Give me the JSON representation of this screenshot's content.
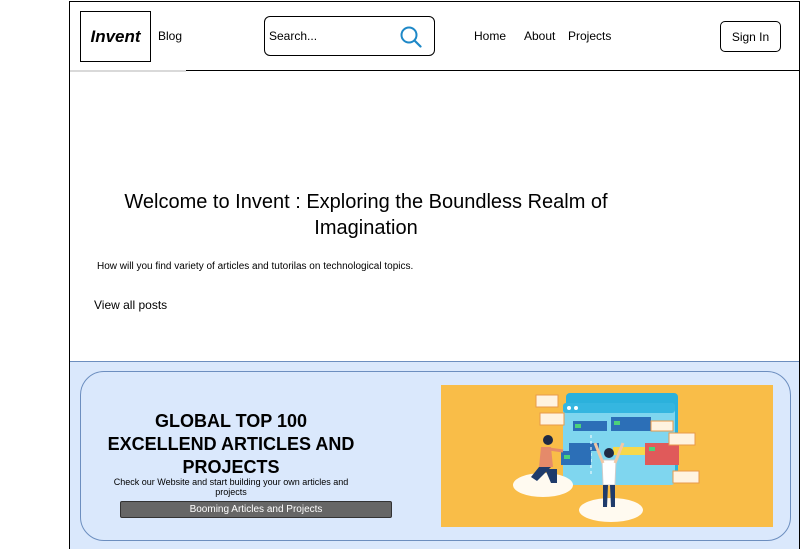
{
  "header": {
    "logo": "Invent",
    "blog_label": "Blog",
    "search_placeholder": "Search...",
    "nav": {
      "home": "Home",
      "about": "About",
      "projects": "Projects"
    },
    "sign_in": "Sign In"
  },
  "hero": {
    "title": "Welcome to Invent : Exploring the Boundless Realm of Imagination",
    "subtitle": "How will you find variety of articles and tutorilas on technological topics.",
    "view_all": "View all posts"
  },
  "banner": {
    "title": "GLOBAL TOP 100 EXCELLEND ARTICLES AND PROJECTS",
    "text": "Check our Website and start building your own articles and projects",
    "button": "Booming Articles and Projects",
    "illustration_bg": "#f9bd48"
  },
  "colors": {
    "banner_bg": "#dae8fc",
    "banner_border": "#6c8ebf",
    "search_icon": "#1e88c7",
    "button_bg": "#666666"
  }
}
